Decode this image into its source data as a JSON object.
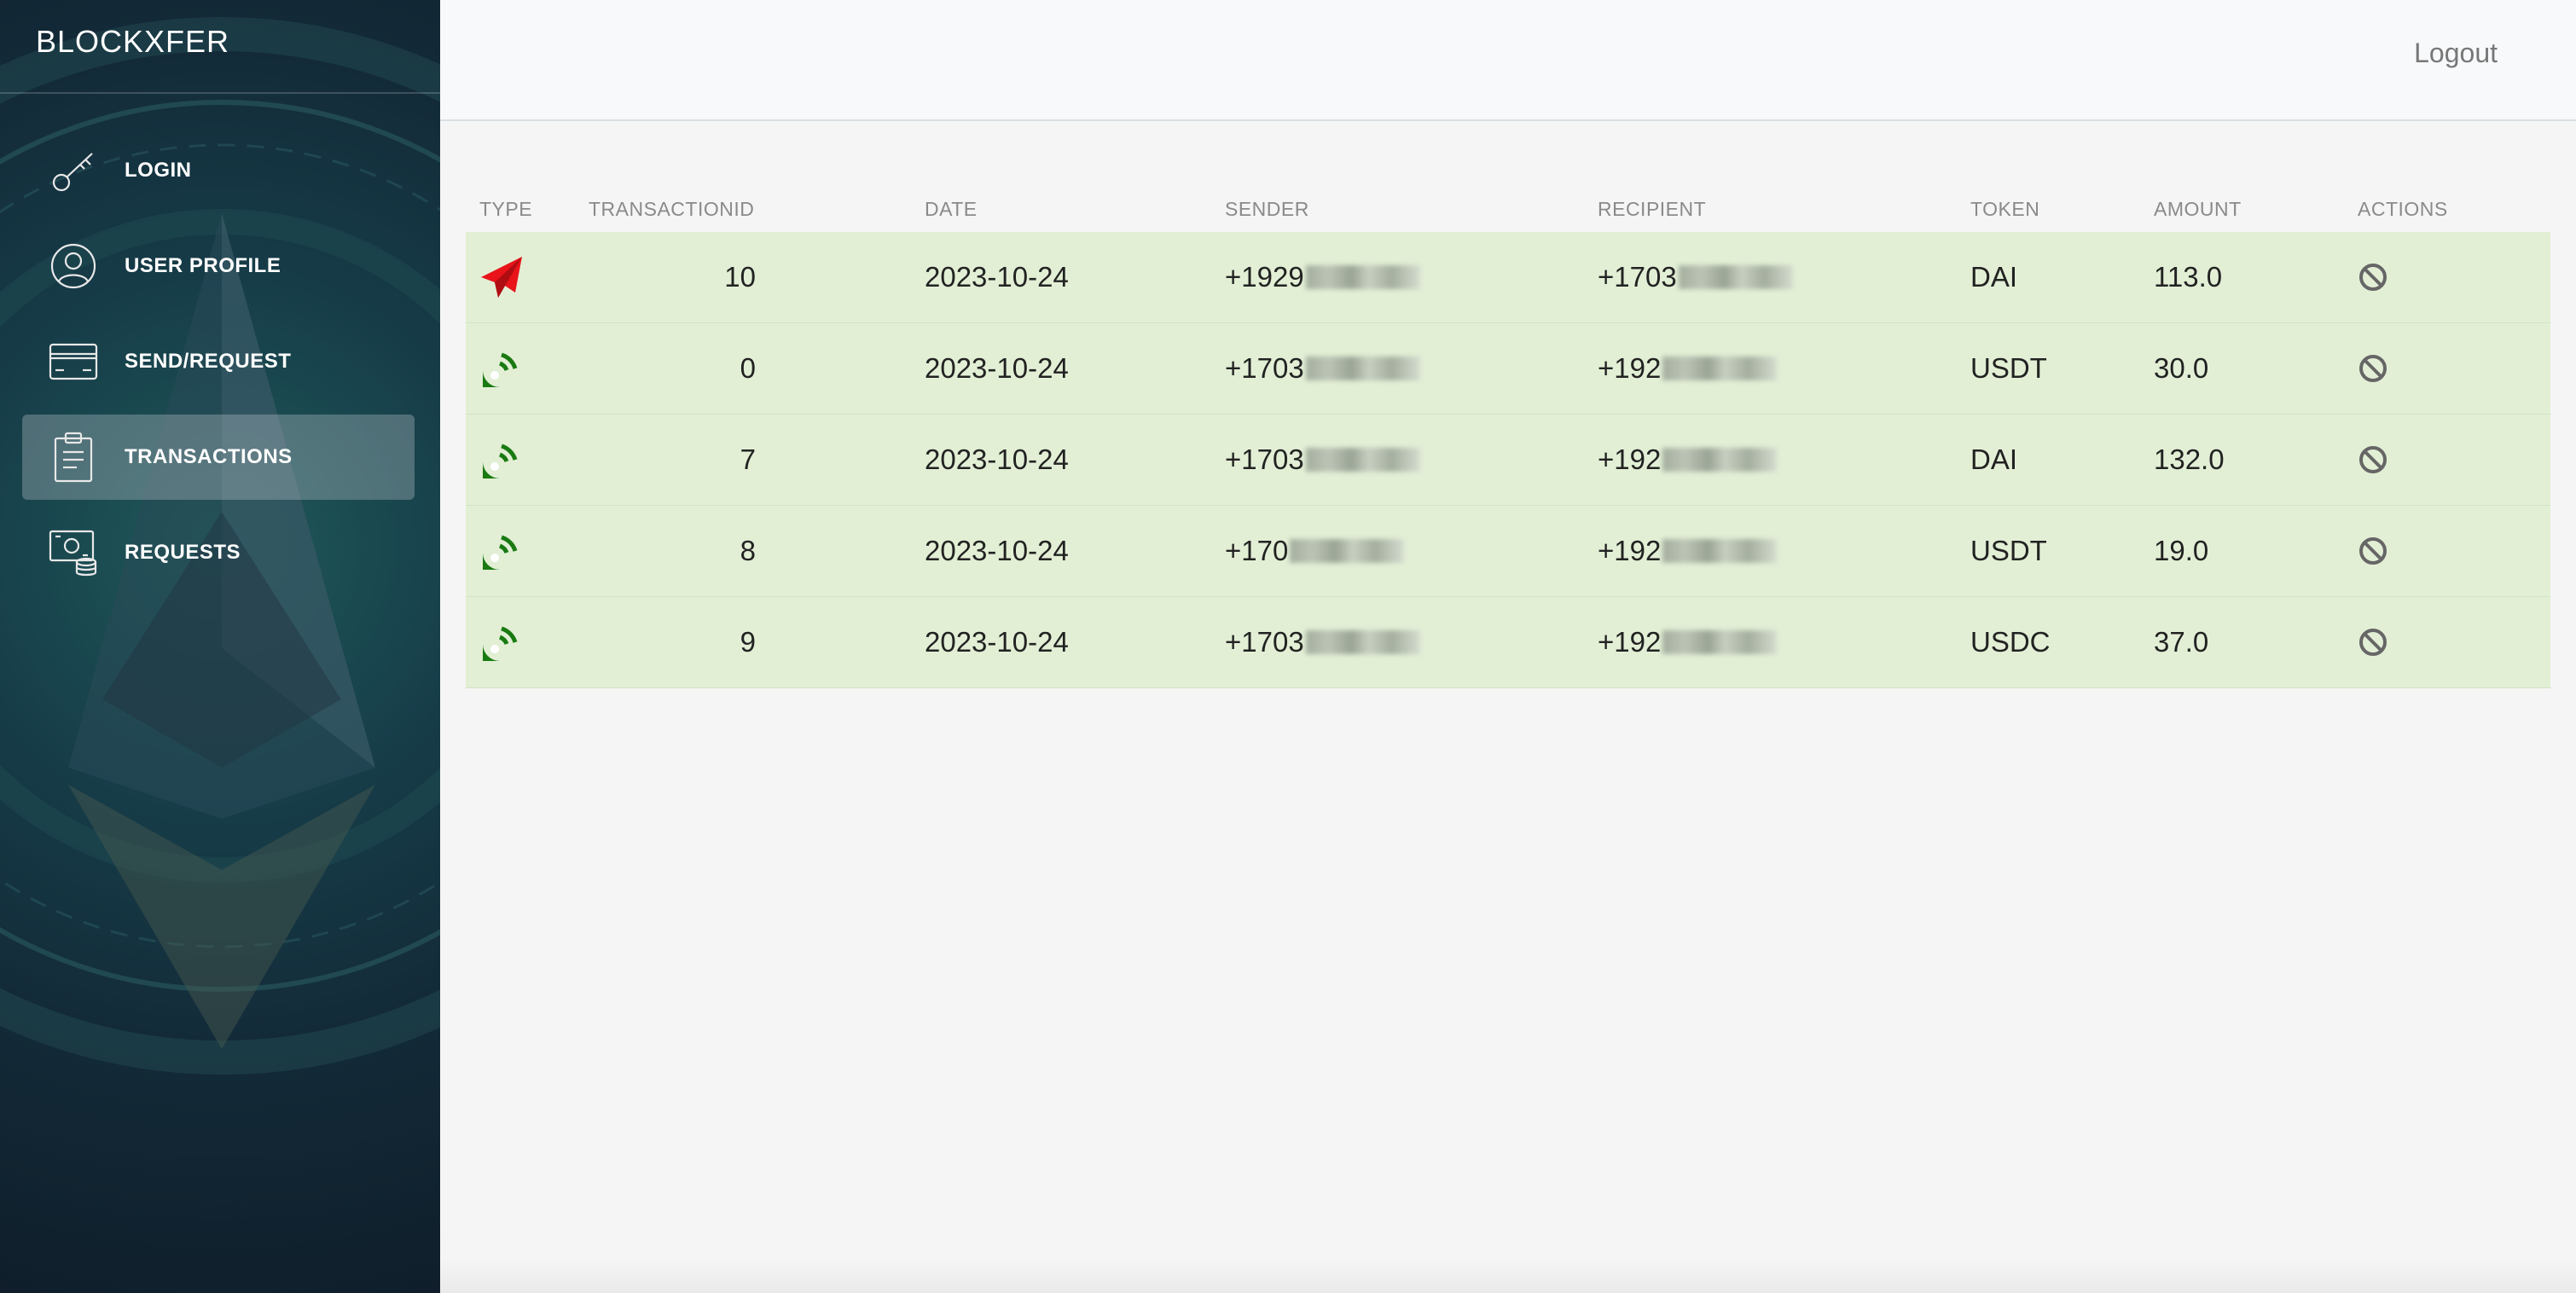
{
  "sidebar": {
    "brand": "BLOCKXFER",
    "items": [
      {
        "label": "LOGIN",
        "icon": "key-icon"
      },
      {
        "label": "USER PROFILE",
        "icon": "user-icon"
      },
      {
        "label": "SEND/REQUEST",
        "icon": "credit-card-icon"
      },
      {
        "label": "TRANSACTIONS",
        "icon": "clipboard-icon",
        "active": true
      },
      {
        "label": "REQUESTS",
        "icon": "cash-coins-icon"
      }
    ]
  },
  "header": {
    "logout": "Logout"
  },
  "table": {
    "headers": [
      "TYPE",
      "TRANSACTIONID",
      "DATE",
      "SENDER",
      "RECIPIENT",
      "TOKEN",
      "AMOUNT",
      "ACTIONS"
    ],
    "rows": [
      {
        "type": "sent",
        "id": "10",
        "date": "2023-10-24",
        "sender": "+1929",
        "recipient": "+1703",
        "token": "DAI",
        "amount": "113.0"
      },
      {
        "type": "received",
        "id": "0",
        "date": "2023-10-24",
        "sender": "+1703",
        "recipient": "+192",
        "token": "USDT",
        "amount": "30.0"
      },
      {
        "type": "received",
        "id": "7",
        "date": "2023-10-24",
        "sender": "+1703",
        "recipient": "+192",
        "token": "DAI",
        "amount": "132.0"
      },
      {
        "type": "received",
        "id": "8",
        "date": "2023-10-24",
        "sender": "+170",
        "recipient": "+192",
        "token": "USDT",
        "amount": "19.0"
      },
      {
        "type": "received",
        "id": "9",
        "date": "2023-10-24",
        "sender": "+1703",
        "recipient": "+192",
        "token": "USDC",
        "amount": "37.0"
      }
    ]
  },
  "colors": {
    "sent": "#e8141a",
    "received": "#1a7a12",
    "row": "#e2efd5"
  }
}
